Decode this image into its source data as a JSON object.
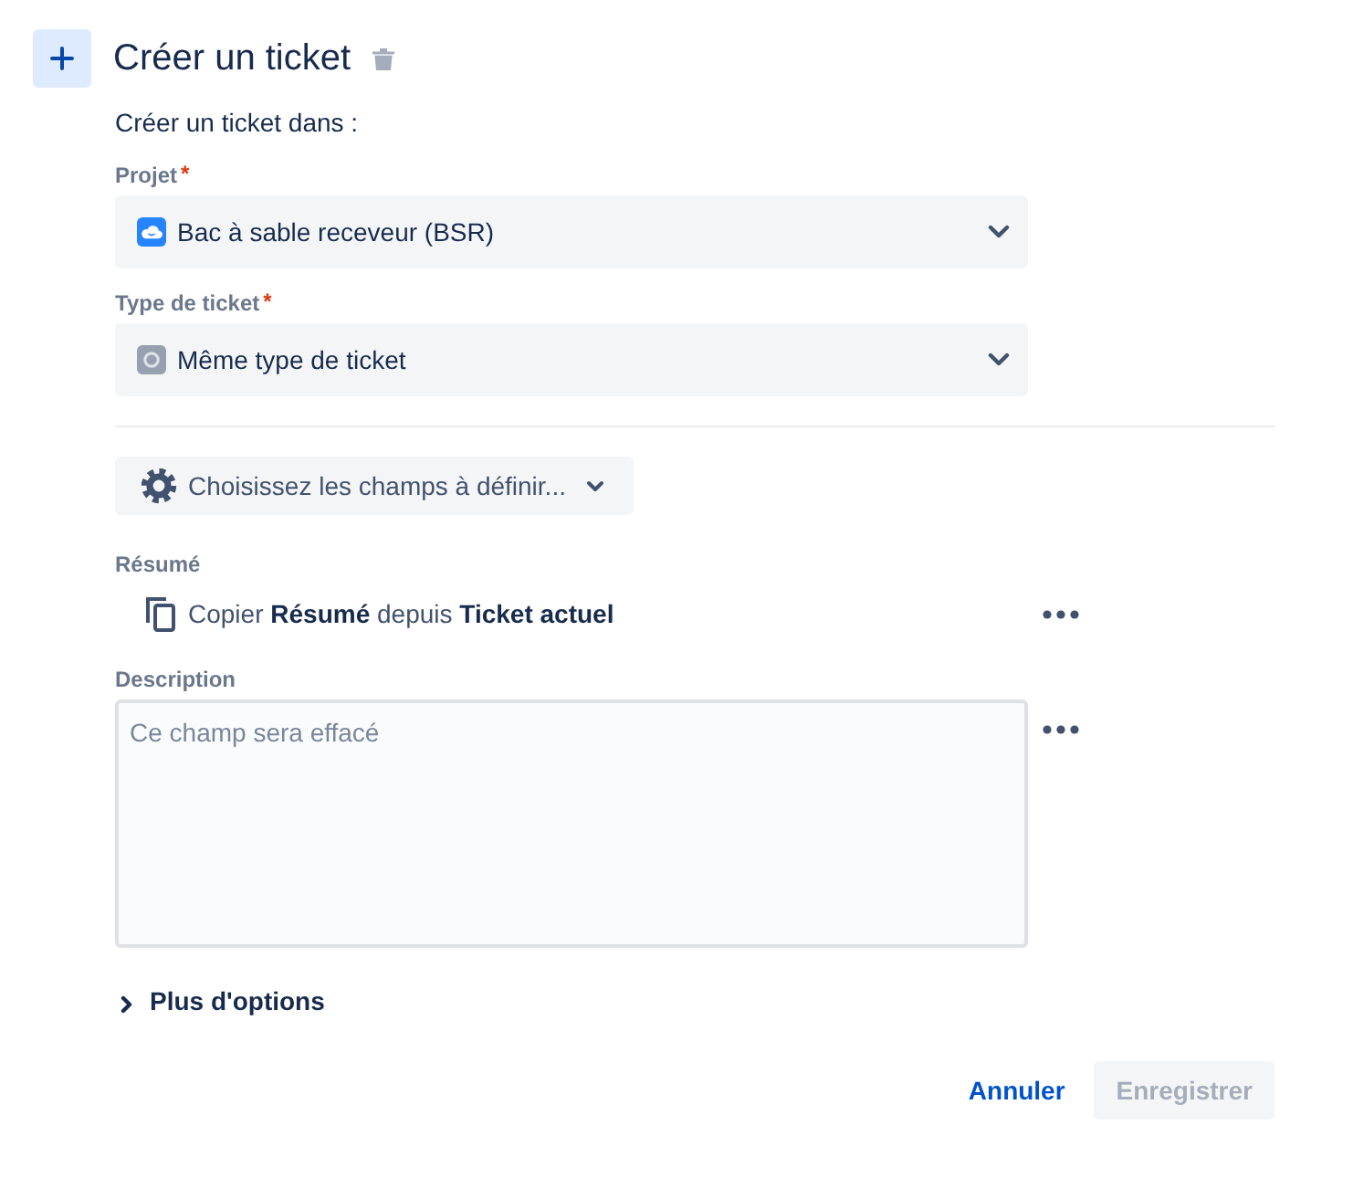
{
  "header": {
    "title": "Créer un ticket"
  },
  "intro": "Créer un ticket dans :",
  "selects": [
    {
      "kind": "project",
      "label": "Projet",
      "required_mark": "*",
      "value": "Bac à sable receveur (BSR)"
    },
    {
      "kind": "issue_type",
      "label": "Type de ticket",
      "required_mark": "*",
      "value": "Même type de ticket"
    }
  ],
  "field_picker": {
    "label": "Choisissez les champs à définir..."
  },
  "fields": [
    {
      "kind": "copy",
      "label": "Résumé",
      "text": "Copier **Résumé** depuis **Ticket actuel**"
    },
    {
      "kind": "textarea",
      "label": "Description",
      "placeholder": "Ce champ sera effacé"
    }
  ],
  "more_options": {
    "label": "Plus d'options",
    "expanded": false
  },
  "actions": [
    {
      "kind": "link",
      "label": "Annuler",
      "disabled": false
    },
    {
      "kind": "button",
      "label": "Enregistrer",
      "disabled": true
    }
  ]
}
